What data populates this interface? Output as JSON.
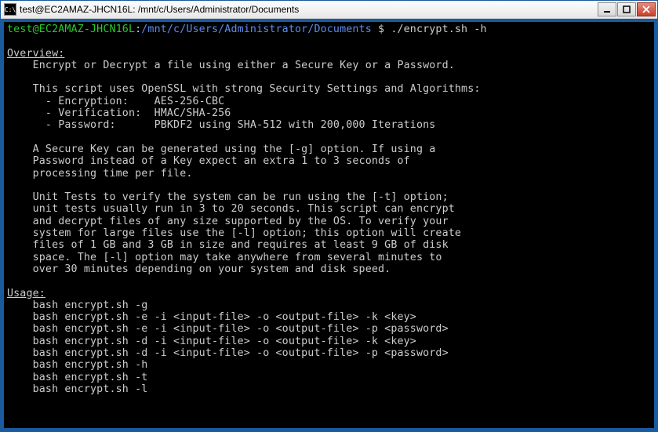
{
  "window": {
    "icon_text": "C:\\",
    "title": "test@EC2AMAZ-JHCN16L: /mnt/c/Users/Administrator/Documents"
  },
  "prompt": {
    "user_host": "test@EC2AMAZ-JHCN16L",
    "sep1": ":",
    "path": "/mnt/c/Users/Administrator/Documents",
    "sigil": "$",
    "command": "./encrypt.sh -h"
  },
  "output": {
    "blank1": "",
    "overview_heading": "Overview:",
    "line1": "    Encrypt or Decrypt a file using either a Secure Key or a Password.",
    "blank2": "",
    "line2": "    This script uses OpenSSL with strong Security Settings and Algorithms:",
    "line3": "      - Encryption:    AES-256-CBC",
    "line4": "      - Verification:  HMAC/SHA-256",
    "line5": "      - Password:      PBKDF2 using SHA-512 with 200,000 Iterations",
    "blank3": "",
    "line6": "    A Secure Key can be generated using the [-g] option. If using a",
    "line7": "    Password instead of a Key expect an extra 1 to 3 seconds of",
    "line8": "    processing time per file.",
    "blank4": "",
    "line9": "    Unit Tests to verify the system can be run using the [-t] option;",
    "line10": "    unit tests usually run in 3 to 20 seconds. This script can encrypt",
    "line11": "    and decrypt files of any size supported by the OS. To verify your",
    "line12": "    system for large files use the [-l] option; this option will create",
    "line13": "    files of 1 GB and 3 GB in size and requires at least 9 GB of disk",
    "line14": "    space. The [-l] option may take anywhere from several minutes to",
    "line15": "    over 30 minutes depending on your system and disk speed.",
    "blank5": "",
    "usage_heading": "Usage:",
    "usage1": "    bash encrypt.sh -g",
    "usage2": "    bash encrypt.sh -e -i <input-file> -o <output-file> -k <key>",
    "usage3": "    bash encrypt.sh -e -i <input-file> -o <output-file> -p <password>",
    "usage4": "    bash encrypt.sh -d -i <input-file> -o <output-file> -k <key>",
    "usage5": "    bash encrypt.sh -d -i <input-file> -o <output-file> -p <password>",
    "usage6": "    bash encrypt.sh -h",
    "usage7": "    bash encrypt.sh -t",
    "usage8": "    bash encrypt.sh -l"
  }
}
